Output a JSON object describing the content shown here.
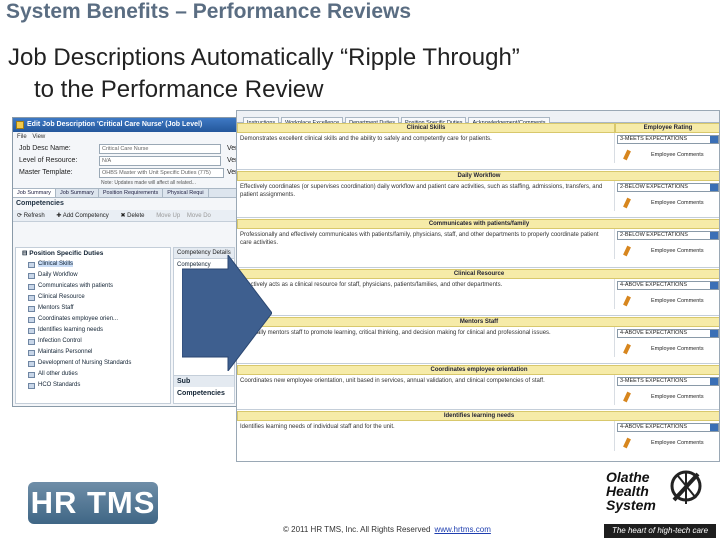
{
  "slide": {
    "title": "System Benefits – Performance Reviews",
    "headline_line1": "Job Descriptions Automatically “Ripple Through”",
    "headline_line2": "to the Performance Review"
  },
  "edit_window": {
    "title": "Edit Job Description 'Critical Care Nurse' (Job Level)",
    "toolbar": [
      "File",
      "View"
    ],
    "fields": [
      {
        "label": "Job Desc Name:",
        "value": "Critical Care Nurse",
        "trail": "Ver"
      },
      {
        "label": "Level of Resource:",
        "value": "N/A",
        "trail": "Ver"
      },
      {
        "label": "Master Template:",
        "value": "OHBS Master with Unit Specific Duties (775)",
        "trail": "Ver"
      }
    ],
    "note": "Note: Updates made will affect all related...",
    "tabs": [
      "Job Summary",
      "Job Summary",
      "Position Requirements",
      "Physical Requi"
    ],
    "competencies_label": "Competencies",
    "comp_toolbar": [
      "Refresh",
      "Add Competency",
      "Delete",
      "Move Up",
      "Move Do"
    ],
    "tree_root": "Position Specific Duties",
    "tree_items": [
      "Clinical Skills",
      "Daily Workflow",
      "Communicates with patients",
      "Clinical Resource",
      "Mentors Staff",
      "Coordinates employee orien...",
      "Identifies learning needs",
      "Infection Control",
      "Maintains Personnel",
      "Development of Nursing Standards",
      "All other duties",
      "HCO Standards"
    ],
    "side_header": "Competency Details",
    "side_cell": "Competency",
    "sub_header": "Sub Competencies"
  },
  "review": {
    "tabs": [
      "Instructions",
      "Workplace Excellence",
      "Department Duties",
      "Position Specific Duties",
      "Acknowledgement/Comments"
    ],
    "employee_rating_header": "Employee Rating",
    "employee_comments_label": "Employee Comments",
    "sections": [
      {
        "title": "Clinical Skills",
        "desc": "Demonstrates excellent clinical skills and the ability to safely and competently care for patients.",
        "rating": "3-MEETS EXPECTATIONS"
      },
      {
        "title": "Daily Workflow",
        "desc": "Effectively coordinates (or supervises coordination) daily workflow and patient care activities, such as staffing, admissions, transfers, and patient assignments.",
        "rating": "2-BELOW EXPECTATIONS"
      },
      {
        "title": "Communicates with patients/family",
        "desc": "Professionally and effectively communicates with patients/family, physicians, staff, and other departments to properly coordinate patient care activities.",
        "rating": "2-BELOW EXPECTATIONS"
      },
      {
        "title": "Clinical Resource",
        "desc": "Effectively acts as a clinical resource for staff, physicians, patients/families, and other departments.",
        "rating": "4-ABOVE EXPECTATIONS"
      },
      {
        "title": "Mentors Staff",
        "desc": "Informally mentors staff to promote learning, critical thinking, and decision making for clinical and professional issues.",
        "rating": "4-ABOVE EXPECTATIONS"
      },
      {
        "title": "Coordinates employee orientation",
        "desc": "Coordinates new employee orientation, unit based in services, annual validation, and clinical competencies of staff.",
        "rating": "3-MEETS EXPECTATIONS"
      },
      {
        "title": "Identifies learning needs",
        "desc": "Identifies learning needs of individual staff and for the unit.",
        "rating": "4-ABOVE EXPECTATIONS"
      }
    ]
  },
  "footer": {
    "hrtms_logo": "HR TMS",
    "copyright": "© 2011 HR TMS, Inc.  All Rights Reserved",
    "link": "www.hrtms.com",
    "ohs_name_1": "Olathe",
    "ohs_name_2": "Health",
    "ohs_name_3": "System",
    "ohs_tagline": "The heart of high-tech care"
  },
  "colors": {
    "title": "#5a6d82",
    "section_header": "#f6eba8",
    "window_title": "#24579b",
    "arrow": "#3e5f8f"
  }
}
